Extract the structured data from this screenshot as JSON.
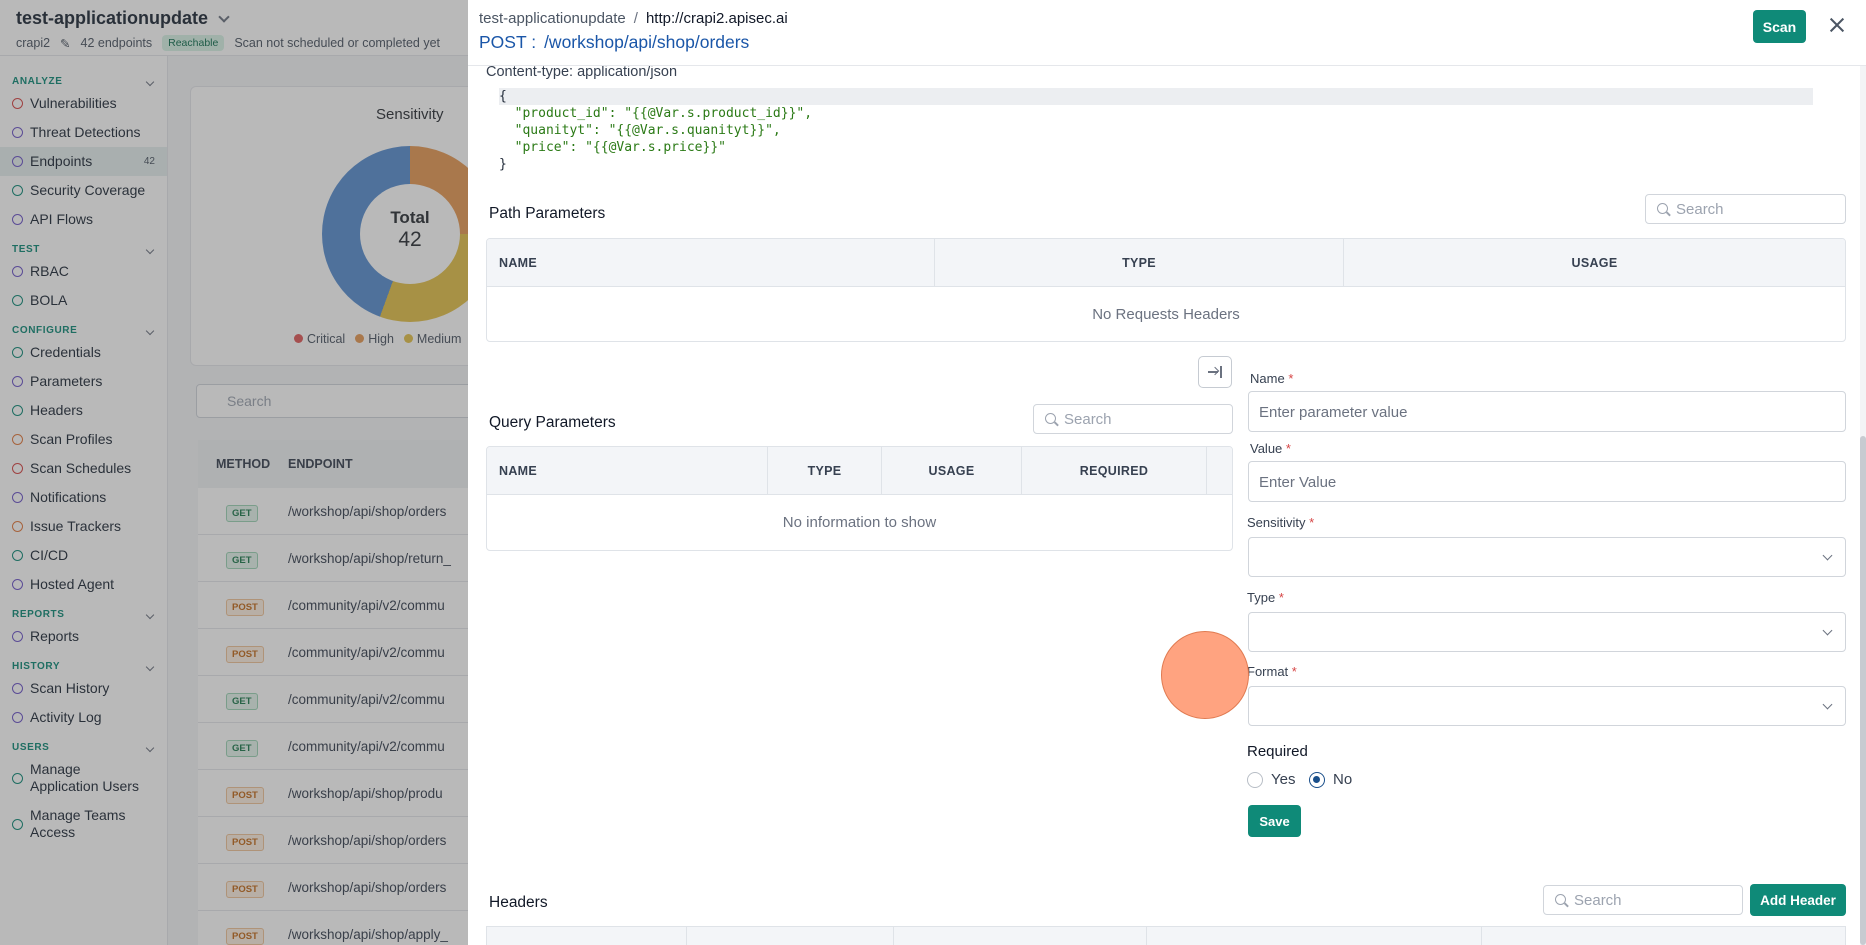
{
  "app": {
    "title": "test-applicationupdate",
    "app_short": "crapi2",
    "endpoints_count": "42 endpoints",
    "reachability": "Reachable",
    "scan_status": "Scan not scheduled or completed yet"
  },
  "sidebar": {
    "sections": [
      {
        "title": "ANALYZE",
        "items": [
          {
            "label": "Vulnerabilities",
            "icon": "shield-alert-icon",
            "color": "red"
          },
          {
            "label": "Threat Detections",
            "icon": "radar-icon",
            "color": "purple"
          },
          {
            "label": "Endpoints",
            "icon": "endpoints-icon",
            "color": "purple",
            "active": true,
            "count": "42"
          },
          {
            "label": "Security Coverage",
            "icon": "coverage-icon",
            "color": "green"
          },
          {
            "label": "API Flows",
            "icon": "flow-icon",
            "color": "purple"
          }
        ]
      },
      {
        "title": "TEST",
        "items": [
          {
            "label": "RBAC",
            "icon": "rbac-icon",
            "color": "purple"
          },
          {
            "label": "BOLA",
            "icon": "bola-icon",
            "color": "green"
          }
        ]
      },
      {
        "title": "CONFIGURE",
        "items": [
          {
            "label": "Credentials",
            "icon": "key-icon",
            "color": "green"
          },
          {
            "label": "Parameters",
            "icon": "braces-icon",
            "color": "purple"
          },
          {
            "label": "Headers",
            "icon": "headers-icon",
            "color": "green"
          },
          {
            "label": "Scan Profiles",
            "icon": "profile-icon",
            "color": "orange"
          },
          {
            "label": "Scan Schedules",
            "icon": "calendar-icon",
            "color": "red"
          },
          {
            "label": "Notifications",
            "icon": "bell-icon",
            "color": "purple"
          },
          {
            "label": "Issue Trackers",
            "icon": "tracker-icon",
            "color": "orange"
          },
          {
            "label": "CI/CD",
            "icon": "cicd-icon",
            "color": "green"
          },
          {
            "label": "Hosted Agent",
            "icon": "agent-icon",
            "color": "purple"
          }
        ]
      },
      {
        "title": "REPORTS",
        "items": [
          {
            "label": "Reports",
            "icon": "report-icon",
            "color": "purple"
          }
        ]
      },
      {
        "title": "HISTORY",
        "items": [
          {
            "label": "Scan History",
            "icon": "history-icon",
            "color": "purple"
          },
          {
            "label": "Activity Log",
            "icon": "log-icon",
            "color": "purple"
          }
        ]
      },
      {
        "title": "USERS",
        "items": [
          {
            "label": "Manage Application Users",
            "icon": "users-icon",
            "color": "green"
          },
          {
            "label": "Manage Teams Access",
            "icon": "team-icon",
            "color": "green"
          }
        ]
      }
    ]
  },
  "background": {
    "sensitivity_title": "Sensitivity",
    "donut_total_label": "Total",
    "donut_total_value": "42",
    "legend": [
      {
        "label": "Critical",
        "color": "#e05a5a"
      },
      {
        "label": "High",
        "color": "#e69a55"
      },
      {
        "label": "Medium",
        "color": "#e3c04a"
      }
    ],
    "search_placeholder": "Search",
    "table_headers": {
      "method": "METHOD",
      "endpoint": "ENDPOINT"
    },
    "rows": [
      {
        "method": "GET",
        "endpoint": "/workshop/api/shop/orders"
      },
      {
        "method": "GET",
        "endpoint": "/workshop/api/shop/return_"
      },
      {
        "method": "POST",
        "endpoint": "/community/api/v2/commu"
      },
      {
        "method": "POST",
        "endpoint": "/community/api/v2/commu"
      },
      {
        "method": "GET",
        "endpoint": "/community/api/v2/commu"
      },
      {
        "method": "GET",
        "endpoint": "/community/api/v2/commu"
      },
      {
        "method": "POST",
        "endpoint": "/workshop/api/shop/produ"
      },
      {
        "method": "POST",
        "endpoint": "/workshop/api/shop/orders"
      },
      {
        "method": "POST",
        "endpoint": "/workshop/api/shop/orders"
      },
      {
        "method": "POST",
        "endpoint": "/workshop/api/shop/apply_"
      }
    ]
  },
  "drawer": {
    "breadcrumb_app": "test-applicationupdate",
    "breadcrumb_sep": "/",
    "breadcrumb_url": "http://crapi2.apisec.ai",
    "method": "POST :",
    "path": "/workshop/api/shop/orders",
    "scan_label": "Scan",
    "content_type": "Content-type: application/json",
    "code_lines": [
      "{",
      "  \"product_id\": \"{{@Var.s.product_id}}\",",
      "  \"quanityt\": \"{{@Var.s.quanityt}}\",",
      "  \"price\": \"{{@Var.s.price}}\"",
      "}"
    ],
    "path_params": {
      "title": "Path Parameters",
      "search_placeholder": "Search",
      "columns": [
        "NAME",
        "TYPE",
        "USAGE"
      ],
      "empty": "No Requests Headers"
    },
    "query_params": {
      "title": "Query Parameters",
      "search_placeholder": "Search",
      "columns": [
        "NAME",
        "TYPE",
        "USAGE",
        "REQUIRED"
      ],
      "empty": "No information to show"
    },
    "form": {
      "name_label": "Name",
      "name_placeholder": "Enter parameter value",
      "value_label": "Value",
      "value_placeholder": "Enter Value",
      "sensitivity_label": "Sensitivity",
      "type_label": "Type",
      "format_label": "Format",
      "required_marker": "*",
      "required_title": "Required",
      "yes_label": "Yes",
      "no_label": "No",
      "selected": "No",
      "save_label": "Save"
    },
    "headers": {
      "title": "Headers",
      "search_placeholder": "Search",
      "add_label": "Add Header"
    }
  },
  "colors": {
    "accent": "#0f8a78",
    "link": "#1a56a8",
    "cursor": "#ff966e"
  }
}
